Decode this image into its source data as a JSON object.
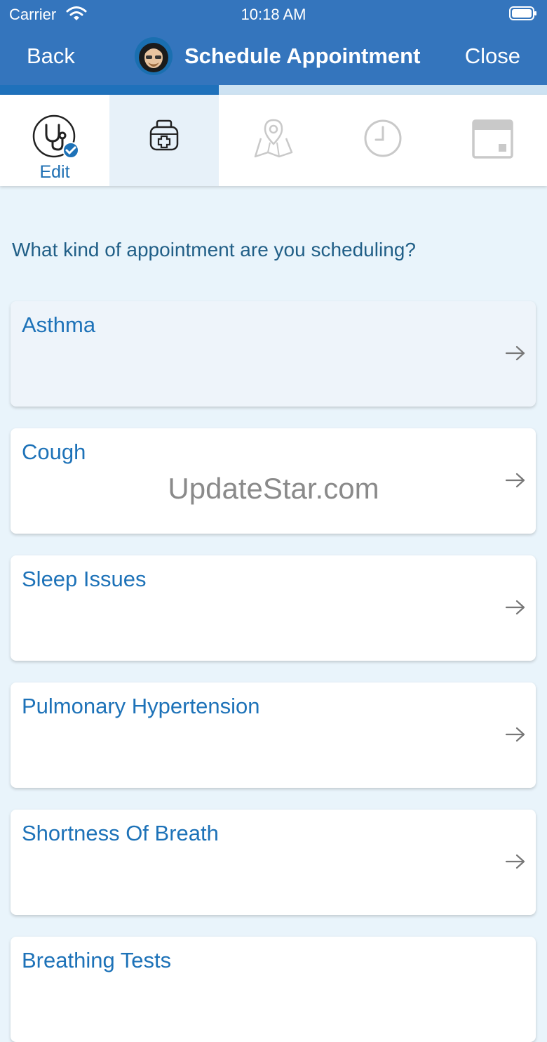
{
  "status_bar": {
    "carrier": "Carrier",
    "time": "10:18 AM"
  },
  "nav": {
    "back_label": "Back",
    "title": "Schedule Appointment",
    "close_label": "Close"
  },
  "progress": {
    "fraction": 0.4
  },
  "steps": [
    {
      "icon": "stethoscope-icon",
      "label": "Edit",
      "completed": true
    },
    {
      "icon": "medical-bag-icon",
      "label": "",
      "active": true
    },
    {
      "icon": "map-pin-icon",
      "label": ""
    },
    {
      "icon": "clock-icon",
      "label": ""
    },
    {
      "icon": "calendar-icon",
      "label": ""
    }
  ],
  "prompt": "What kind of appointment are you scheduling?",
  "options": [
    {
      "label": "Asthma",
      "selected": true
    },
    {
      "label": "Cough"
    },
    {
      "label": "Sleep Issues"
    },
    {
      "label": "Pulmonary Hypertension"
    },
    {
      "label": "Shortness Of Breath"
    },
    {
      "label": "Breathing Tests"
    }
  ],
  "watermark": "UpdateStar.com",
  "colors": {
    "header": "#3475bd",
    "accent": "#1d72b8",
    "background": "#e9f4fb"
  }
}
